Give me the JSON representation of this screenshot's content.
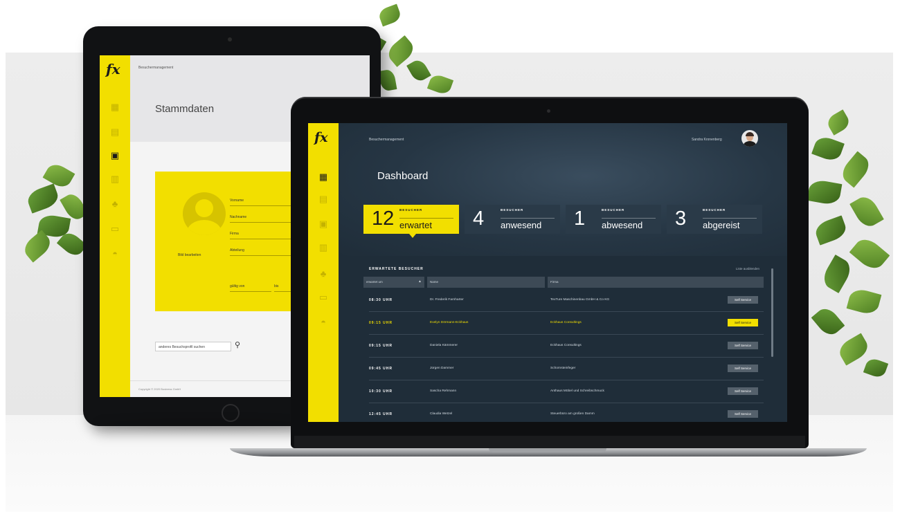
{
  "tablet": {
    "logo": "fx",
    "breadcrumb": "Besuchermanagement",
    "title": "Stammdaten",
    "edit_image": "Bild bearbeiten",
    "fields": [
      "Vorname",
      "Nachname",
      "Firma",
      "Abteilung"
    ],
    "valid_from": "gültig von",
    "valid_to": "bis",
    "search_placeholder": "anderes Besuchsprofil suchen",
    "copyright": "Copyright © 2020 Business GmbH",
    "nav_icons": [
      "dashboard-icon",
      "calendar-icon",
      "id-card-icon",
      "building-icon",
      "group-icon",
      "document-icon",
      "user-icon"
    ]
  },
  "laptop": {
    "logo": "fx",
    "breadcrumb": "Besuchermanagement",
    "user": "Sandra Kronenberg",
    "title": "Dashboard",
    "nav_icons": [
      "dashboard-icon",
      "calendar-icon",
      "id-card-icon",
      "building-icon",
      "group-icon",
      "document-icon",
      "user-icon"
    ],
    "stats": [
      {
        "num": "12",
        "small": "BESUCHER",
        "big": "erwartet"
      },
      {
        "num": "4",
        "small": "BESUCHER",
        "big": "anwesend"
      },
      {
        "num": "1",
        "small": "BESUCHER",
        "big": "abwesend"
      },
      {
        "num": "3",
        "small": "BESUCHER",
        "big": "abgereist"
      }
    ],
    "list_title": "ERWARTETE BESUCHER",
    "list_hide": "Liste ausblenden",
    "columns": [
      "erwartet um",
      "Name",
      "Firma"
    ],
    "sort_icon": "▲",
    "rows": [
      {
        "time": "08:30 UHR",
        "name": "Dr. Frederik Farnharter",
        "firm": "TexTure Maschinenbau GmbH & Co KG",
        "action": "Self Service"
      },
      {
        "time": "09:15 UHR",
        "name": "Evelyn Dörmann-Eckhaus",
        "firm": "Eckhaus Consultings",
        "action": "Self Service"
      },
      {
        "time": "09:15 UHR",
        "name": "Daniela Kämmerer",
        "firm": "Eckhaus Consultings",
        "action": "Self Service"
      },
      {
        "time": "09:45 UHR",
        "name": "Jürgen Dammer",
        "firm": "Schornsteinfeger",
        "action": "Self Service"
      },
      {
        "time": "10:30 UHR",
        "name": "Sascha Rehmann",
        "firm": "Anthaus Möbel und Schreibschmuck",
        "action": "Self Service"
      },
      {
        "time": "12:45 UHR",
        "name": "Claudia Wetzel",
        "firm": "Steuerbüro am großen Damm",
        "action": "Self Service"
      }
    ]
  },
  "colors": {
    "accent": "#f2df00",
    "dark": "#1f2d39"
  }
}
